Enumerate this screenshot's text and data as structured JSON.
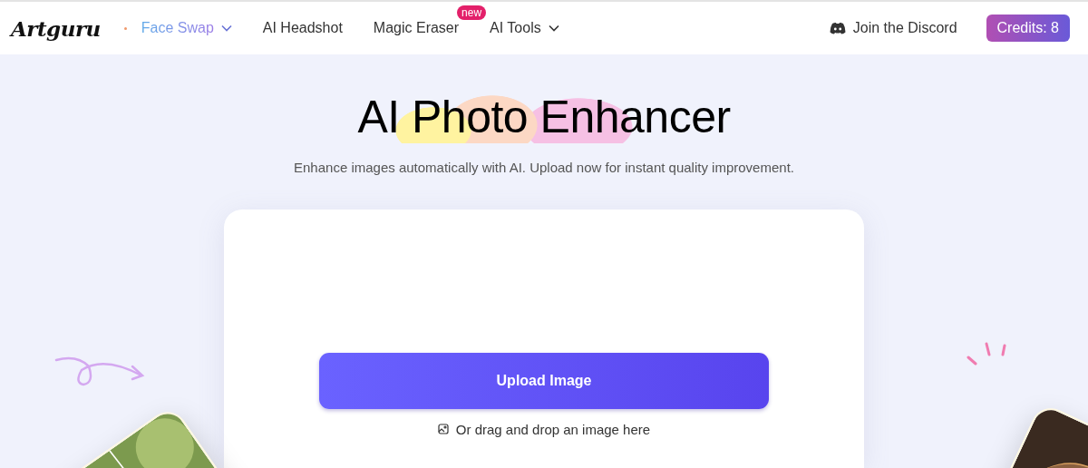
{
  "header": {
    "logo": "Artguru",
    "nav": [
      {
        "label": "Face Swap",
        "selected": true,
        "has_menu": true
      },
      {
        "label": "AI Headshot",
        "selected": false,
        "has_menu": false
      },
      {
        "label": "Magic Eraser",
        "selected": false,
        "has_menu": false,
        "badge": "new"
      },
      {
        "label": "AI Tools",
        "selected": false,
        "has_menu": true
      }
    ],
    "discord_link": "Join the Discord",
    "credits": "Credits: 8"
  },
  "hero": {
    "title": "AI Photo Enhancer",
    "subtitle": "Enhance images automatically with AI. Upload now for instant quality improvement."
  },
  "upload": {
    "button": "Upload Image",
    "hint": "Or drag and drop an image here"
  }
}
